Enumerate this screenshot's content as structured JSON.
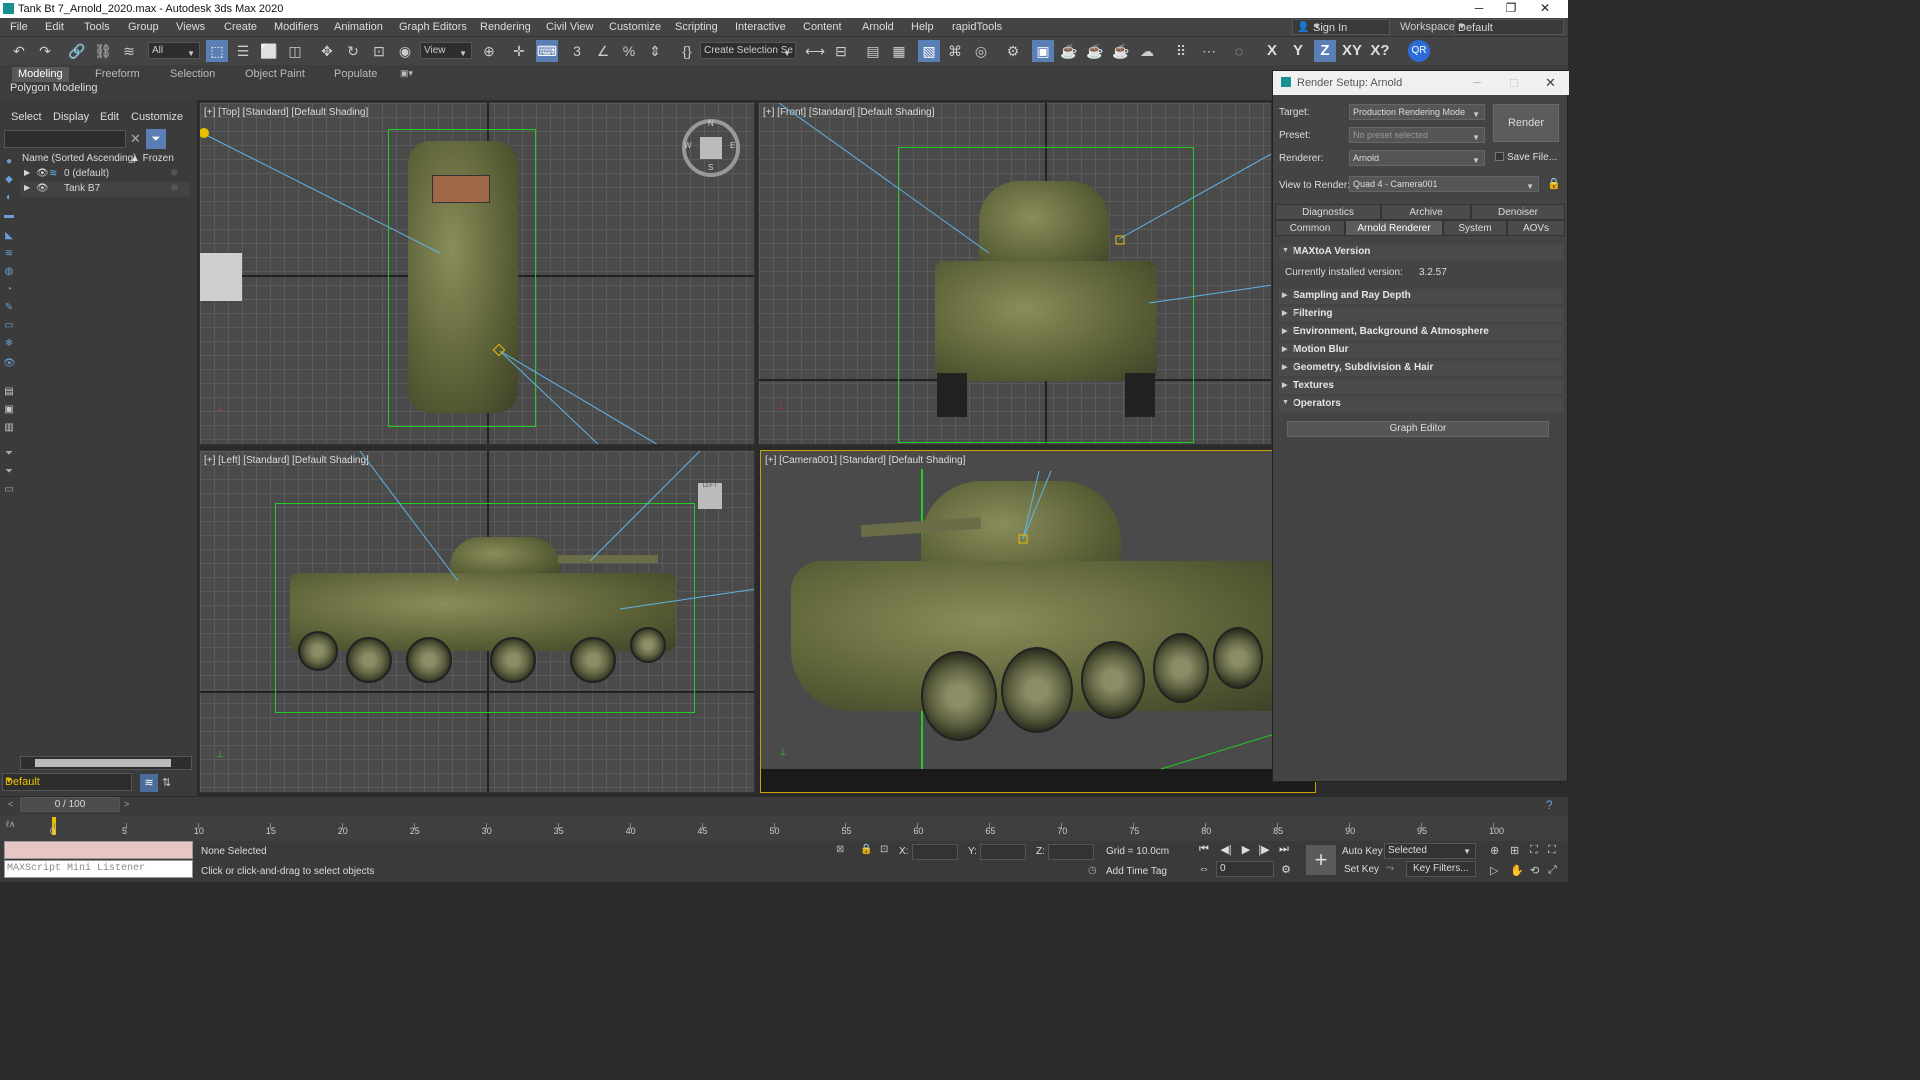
{
  "window": {
    "title": "Tank Bt 7_Arnold_2020.max - Autodesk 3ds Max 2020",
    "minimize": "─",
    "maximize": "❐",
    "close": "✕"
  },
  "menu": [
    "File",
    "Edit",
    "Tools",
    "Group",
    "Views",
    "Create",
    "Modifiers",
    "Animation",
    "Graph Editors",
    "Rendering",
    "Civil View",
    "Customize",
    "Scripting",
    "Interactive",
    "Content",
    "Arnold",
    "Help",
    "rapidTools"
  ],
  "signin": "Sign In",
  "workspaces": {
    "label": "Workspaces:",
    "value": "Default"
  },
  "toolbar": {
    "filter": "All",
    "refcoord": "View",
    "selset": "Create Selection Se",
    "axes": [
      "X",
      "Y",
      "Z",
      "XY",
      "X?"
    ]
  },
  "ribbon": {
    "tabs": [
      "Modeling",
      "Freeform",
      "Selection",
      "Object Paint",
      "Populate"
    ],
    "panel": "Polygon Modeling"
  },
  "scene": {
    "menus": [
      "Select",
      "Display",
      "Edit",
      "Customize"
    ],
    "col_name": "Name (Sorted Ascending)",
    "col_frozen": "▲ Frozen",
    "rows": [
      "0 (default)",
      "Tank B7"
    ],
    "layer": "Default"
  },
  "viewports": {
    "top": "[+] [Top] [Standard] [Default Shading]",
    "front": "[+] [Front] [Standard] [Default Shading]",
    "left": "[+] [Left] [Standard] [Default Shading]",
    "camera": "[+] [Camera001] [Standard] [Default Shading]",
    "compass": [
      "N",
      "S",
      "E",
      "W"
    ]
  },
  "render_setup": {
    "title": "Render Setup: Arnold",
    "target_label": "Target:",
    "target": "Production Rendering Mode",
    "preset_label": "Preset:",
    "preset": "No preset selected",
    "renderer_label": "Renderer:",
    "renderer": "Arnold",
    "savefile": "Save File",
    "more": "...",
    "view_label": "View to Render:",
    "view": "Quad 4 - Camera001",
    "render_btn": "Render",
    "tabs_row1": [
      "Diagnostics",
      "Archive",
      "Denoiser"
    ],
    "tabs_row2": [
      "Common",
      "Arnold Renderer",
      "System",
      "AOVs"
    ],
    "maxtoa": "MAXtoA Version",
    "version_label": "Currently installed version:",
    "version": "3.2.57",
    "rollouts": [
      "Sampling and Ray Depth",
      "Filtering",
      "Environment, Background & Atmosphere",
      "Motion Blur",
      "Geometry, Subdivision & Hair",
      "Textures",
      "Operators"
    ],
    "graph_editor": "Graph Editor"
  },
  "timeline": {
    "frame": "0 / 100",
    "ticks": [
      "0",
      "5",
      "10",
      "15",
      "20",
      "25",
      "30",
      "35",
      "40",
      "45",
      "50",
      "55",
      "60",
      "65",
      "70",
      "75",
      "80",
      "85",
      "90",
      "95",
      "100"
    ]
  },
  "status": {
    "maxscript": "MAXScript Mini Listener",
    "selected": "None Selected",
    "hint": "Click or click-and-drag to select objects",
    "x": "X:",
    "y": "Y:",
    "z": "Z:",
    "grid": "Grid = 10.0cm",
    "addtime": "Add Time Tag",
    "autokey": "Auto Key",
    "setkey": "Set Key",
    "keymode": "Selected",
    "keyfilters": "Key Filters...",
    "curframe": "0"
  }
}
